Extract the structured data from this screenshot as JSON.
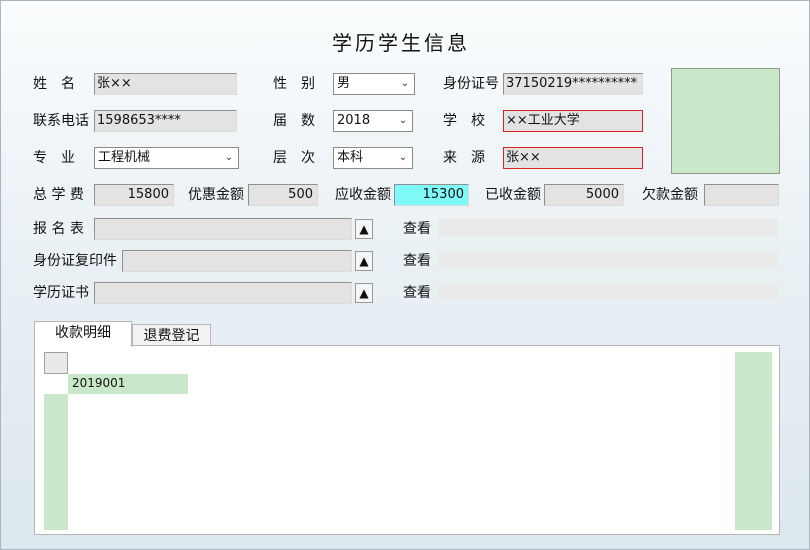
{
  "form": {
    "title": "学历学生信息",
    "name_label": "姓　名",
    "name_value": "张××",
    "gender_label": "性　别",
    "gender_value": "男",
    "idcard_label": "身份证号",
    "idcard_value": "37150219**********",
    "phone_label": "联系电话",
    "phone_value": "1598653****",
    "cohort_label": "届　数",
    "cohort_value": "2018",
    "school_label": "学　校",
    "school_value": "××工业大学",
    "major_label": "专　业",
    "major_value": "工程机械",
    "level_label": "层　次",
    "level_value": "本科",
    "source_label": "来　源",
    "source_value": "张××"
  },
  "fees": {
    "total_label": "总 学 费",
    "total_value": "15800",
    "discount_label": "优惠金额",
    "discount_value": "500",
    "due_label": "应收金额",
    "due_value": "15300",
    "received_label": "已收金额",
    "received_value": "5000",
    "owed_label": "欠款金额",
    "owed_value": ""
  },
  "attachments": [
    {
      "label": "报 名 表",
      "view": "查看"
    },
    {
      "label": "身份证复印件",
      "view": "查看"
    },
    {
      "label": "学历证书",
      "view": "查看"
    }
  ],
  "tabs": [
    {
      "label": "收款明细"
    },
    {
      "label": "退费登记"
    }
  ],
  "grid": {
    "rows": [
      [
        "2019001"
      ]
    ]
  },
  "icons": {
    "combo_arrow": "chevron-down-icon",
    "upload": "triangle-up-icon"
  },
  "colors": {
    "accent_field": "#7ff8f8",
    "grid_fill": "#c9e8ca",
    "invalid_border": "#dd2222"
  }
}
